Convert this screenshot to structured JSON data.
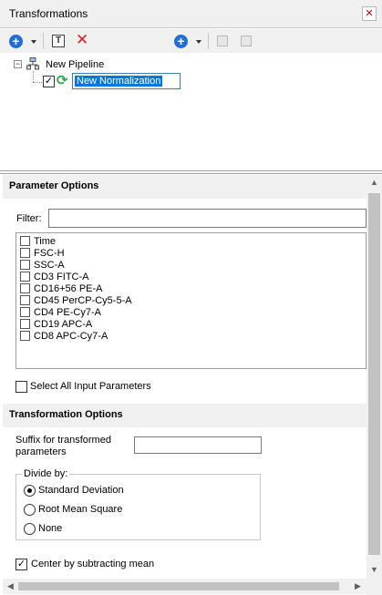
{
  "window": {
    "title": "Transformations",
    "close_glyph": "✕"
  },
  "toolbar": {
    "add_icon": "plus-circle-icon",
    "dropdown_icon": "chevron-down-icon",
    "rename_icon": "text-box-icon",
    "delete_icon": "delete-x-icon",
    "add_step_icon": "plus-circle-icon",
    "move_up_icon": "move-up-icon",
    "move_down_icon": "move-down-icon",
    "accent_color": "#1f6fd6",
    "delete_color": "#e02020"
  },
  "tree": {
    "root_label": "New Pipeline",
    "root_icon": "pipeline-icon",
    "node_label": "New Normalization",
    "node_checked": true,
    "node_icon": "refresh-icon"
  },
  "parameter_options": {
    "header": "Parameter Options",
    "filter_label": "Filter:",
    "filter_value": "",
    "parameters": [
      "Time",
      "FSC-H",
      "SSC-A",
      "CD3 FITC-A",
      "CD16+56 PE-A",
      "CD45 PerCP-Cy5-5-A",
      "CD4 PE-Cy7-A",
      "CD19 APC-A",
      "CD8 APC-Cy7-A"
    ],
    "select_all_label": "Select All Input Parameters",
    "select_all_checked": false
  },
  "transformation_options": {
    "header": "Transformation Options",
    "suffix_label": "Suffix for transformed parameters",
    "suffix_value": "",
    "divide_by_label": "Divide by:",
    "divide_by_options": [
      "Standard Deviation",
      "Root Mean Square",
      "None"
    ],
    "divide_by_selected": "Standard Deviation",
    "center_label": "Center by subtracting mean",
    "center_checked": true
  },
  "scrollbars": {
    "up": "▲",
    "down": "▼",
    "left": "◀",
    "right": "▶"
  }
}
